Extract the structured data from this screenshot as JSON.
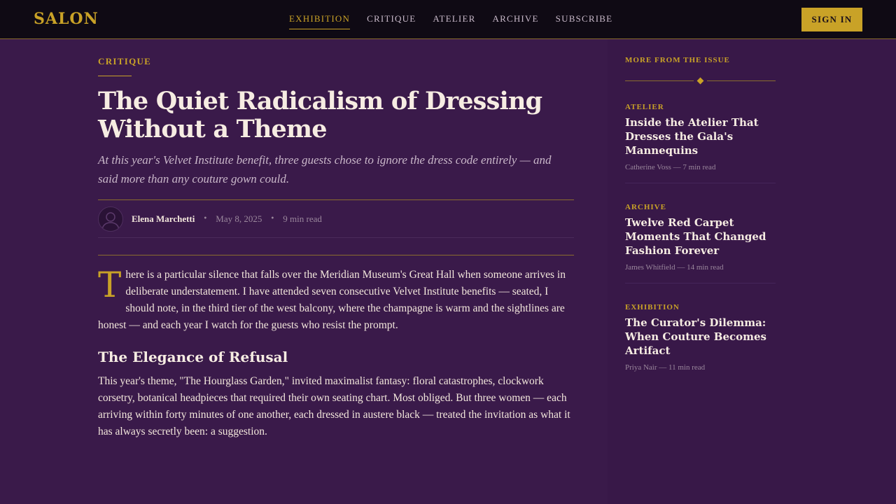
{
  "header": {
    "logo": "SALON",
    "nav": [
      {
        "label": "EXHIBITION",
        "active": true
      },
      {
        "label": "CRITIQUE",
        "active": false
      },
      {
        "label": "ATELIER",
        "active": false
      },
      {
        "label": "ARCHIVE",
        "active": false
      },
      {
        "label": "SUBSCRIBE",
        "active": false
      }
    ],
    "signin_label": "SIGN IN"
  },
  "article": {
    "kicker": "CRITIQUE",
    "title": "The Quiet Radicalism of Dressing Without a Theme",
    "dek": "At this year's Velvet Institute benefit, three guests chose to ignore the dress code entirely — and said more than any couture gown could.",
    "author": "Elena Marchetti",
    "date": "May 8, 2025",
    "read_time": "9 min read",
    "dropcap": "T",
    "p1": "here is a particular silence that falls over the Meridian Museum's Great Hall when someone arrives in deliberate understatement. I have attended seven consecutive Velvet Institute benefits — seated, I should note, in the third tier of the west balcony, where the champagne is warm and the sightlines are honest — and each year I watch for the guests who resist the prompt.",
    "h2": "The Elegance of Refusal",
    "p2": "This year's theme, \"The Hourglass Garden,\" invited maximalist fantasy: floral catastrophes, clockwork corsetry, botanical headpieces that required their own seating chart. Most obliged. But three women — each arriving within forty minutes of one another, each dressed in austere black — treated the invitation as what it has always secretly been: a suggestion."
  },
  "sidebar": {
    "heading": "MORE FROM THE ISSUE",
    "items": [
      {
        "category": "ATELIER",
        "title": "Inside the Atelier That Dresses the Gala's Mannequins",
        "meta": "Catherine Voss — 7 min read"
      },
      {
        "category": "ARCHIVE",
        "title": "Twelve Red Carpet Moments That Changed Fashion Forever",
        "meta": "James Whitfield — 14 min read"
      },
      {
        "category": "EXHIBITION",
        "title": "The Curator's Dilemma: When Couture Becomes Artifact",
        "meta": "Priya Nair — 11 min read"
      }
    ]
  },
  "icons": {
    "avatar": "user-silhouette-icon",
    "ornament": "diamond-icon"
  },
  "colors": {
    "accent": "#c9a227",
    "background": "#3a1a4a",
    "topbar": "#0f0a14"
  }
}
